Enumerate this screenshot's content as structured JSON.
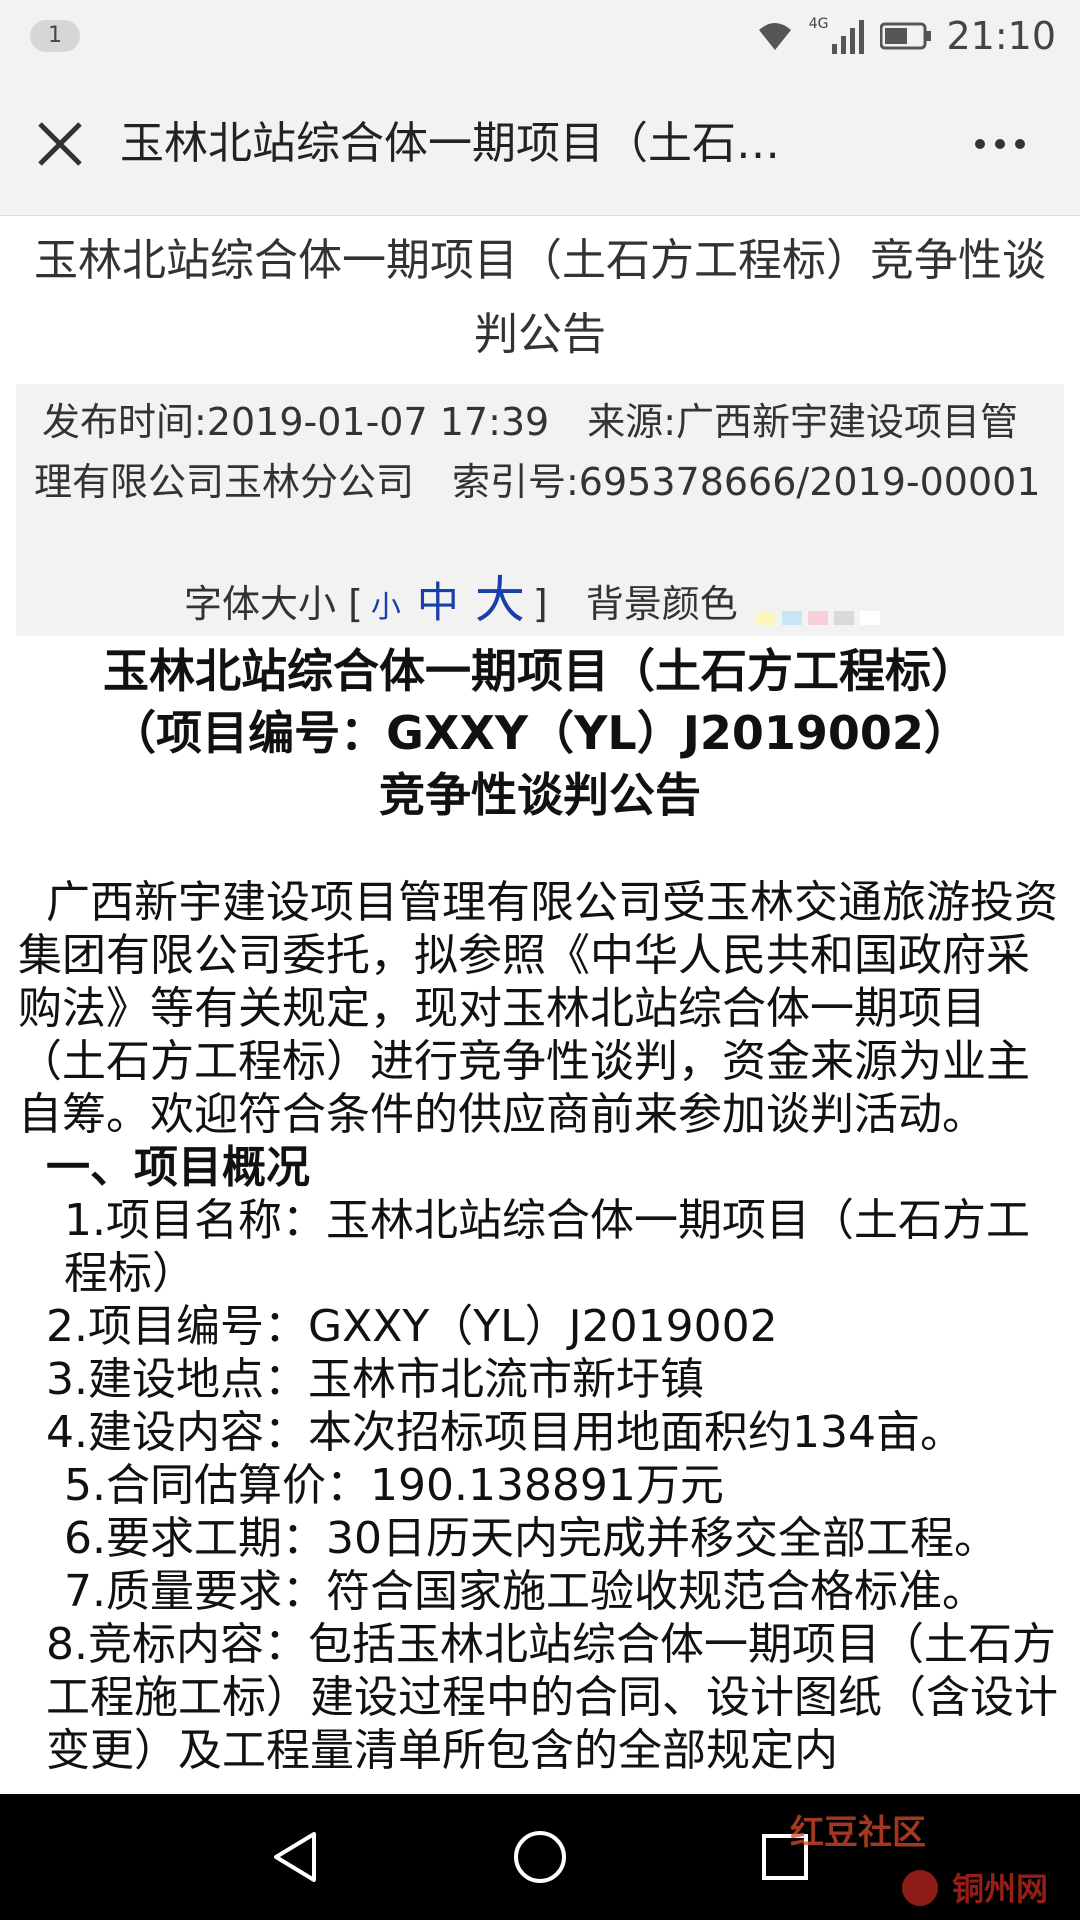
{
  "status_bar": {
    "notification_count": "1",
    "network": "4G",
    "time": "21:10"
  },
  "title_bar": {
    "title": "玉林北站综合体一期项目（土石…"
  },
  "page": {
    "heading": "玉林北站综合体一期项目（土石方工程标）竞争性谈判公告",
    "meta": {
      "line1": "发布时间:2019-01-07 17:39　来源:广西新宇建设项目管",
      "line2": "理有限公司玉林分公司　索引号:695378666/2019-00001"
    },
    "font_size_label": "字体大小 [",
    "font_small": "小",
    "font_medium": "中",
    "font_large": "大",
    "font_close": "]",
    "bg_color_label": "背景颜色",
    "bg_swatches": [
      "#fbf6c0",
      "#c6e6f5",
      "#f7cfd9",
      "#d9d9d9",
      "#ffffff"
    ]
  },
  "notice": {
    "title_line1": "玉林北站综合体一期项目（土石方工程标）",
    "title_line2": "（项目编号：GXXY（YL）J2019002）",
    "title_line3": "竞争性谈判公告",
    "intro": "广西新宇建设项目管理有限公司受玉林交通旅游投资集团有限公司委托，拟参照《中华人民共和国政府采购法》等有关规定，现对玉林北站综合体一期项目（土石方工程标）进行竞争性谈判，资金来源为业主自筹。欢迎符合条件的供应商前来参加谈判活动。",
    "section1": "一、项目概况",
    "items": [
      "1.项目名称：玉林北站综合体一期项目（土石方工程标）",
      "2.项目编号：GXXY（YL）J2019002",
      "3.建设地点：玉林市北流市新圩镇",
      "4.建设内容：本次招标项目用地面积约134亩。",
      "5.合同估算价：190.138891万元",
      "6.要求工期：30日历天内完成并移交全部工程。",
      "7.质量要求：符合国家施工验收规范合格标准。",
      "8.竞标内容：包括玉林北站综合体一期项目（土石方工程施工标）建设过程中的合同、设计图纸（含设计变更）及工程量清单所包含的全部规定内"
    ]
  },
  "watermark": {
    "brand": "红豆社区",
    "site": "铜州网"
  }
}
